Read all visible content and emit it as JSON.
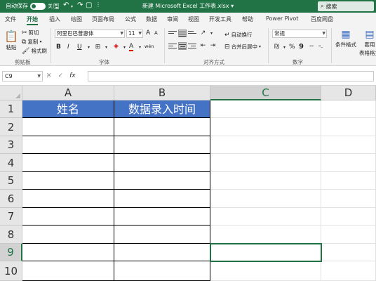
{
  "titlebar": {
    "autosave_label": "自动保存",
    "autosave_state": "关",
    "title": "新建 Microsoft Excel 工作表.xlsx",
    "title_suffix": "▾",
    "search_placeholder": "搜索",
    "accent_color": "#217346"
  },
  "tabs": [
    "文件",
    "开始",
    "插入",
    "绘图",
    "页面布局",
    "公式",
    "数据",
    "审阅",
    "视图",
    "开发工具",
    "帮助",
    "Power Pivot",
    "百度网盘"
  ],
  "active_tab": "开始",
  "ribbon": {
    "clipboard": {
      "paste": "粘贴",
      "cut": "剪切",
      "copy": "复制",
      "format_painter": "格式刷",
      "group_label": "剪贴板"
    },
    "font": {
      "font_name": "阿里巴巴普惠体",
      "font_size": "11",
      "bold": "B",
      "italic": "I",
      "underline": "U",
      "font_color_glyph": "A",
      "bigger_font": "A",
      "smaller_font": "A",
      "phonetic": "wén",
      "group_label": "字体"
    },
    "alignment": {
      "wrap_text": "自动换行",
      "merge_center": "合并后居中",
      "group_label": "对齐方式"
    },
    "number": {
      "format": "常规",
      "percent": "%",
      "comma": "9",
      "group_label": "数字"
    },
    "styles": {
      "conditional_format": "条件格式",
      "table_format": "套用",
      "table_format_2": "表格格式"
    }
  },
  "formula_bar": {
    "name_box": "C9",
    "cancel": "✕",
    "enter": "✓",
    "fx": "fx",
    "value": ""
  },
  "sheet": {
    "columns": [
      "A",
      "B",
      "C",
      "D"
    ],
    "rows": [
      "1",
      "2",
      "3",
      "4",
      "5",
      "6",
      "7",
      "8",
      "9",
      "10"
    ],
    "selected_cell": "C9",
    "header_fill": "#4472c4",
    "cells": {
      "A1": "姓名",
      "B1": "数据录入时间"
    }
  }
}
